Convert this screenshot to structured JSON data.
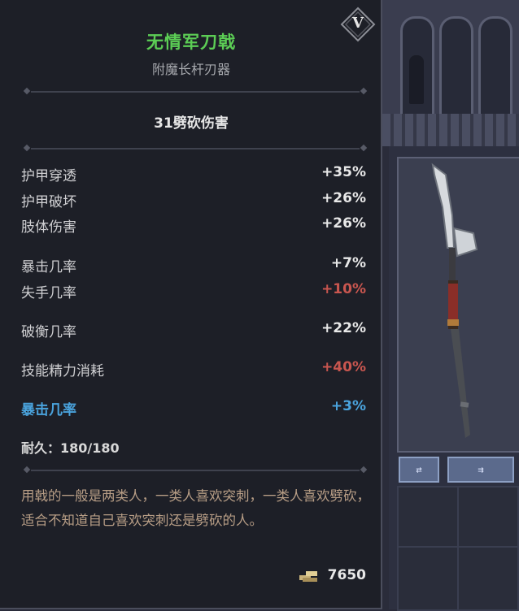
{
  "item": {
    "name": "无情军刀戟",
    "type": "附魔长杆刃器",
    "damage": "31劈砍伤害",
    "rarity_badge": "Ⅴ",
    "stats": [
      {
        "label": "护甲穿透",
        "value": "+35%",
        "tone": "normal"
      },
      {
        "label": "护甲破坏",
        "value": "+26%",
        "tone": "normal"
      },
      {
        "label": "肢体伤害",
        "value": "+26%",
        "tone": "normal"
      },
      {
        "label": "暴击几率",
        "value": "+7%",
        "tone": "normal"
      },
      {
        "label": "失手几率",
        "value": "+10%",
        "tone": "negative"
      },
      {
        "label": "破衡几率",
        "value": "+22%",
        "tone": "normal"
      },
      {
        "label": "技能精力消耗",
        "value": "+40%",
        "tone": "negative"
      },
      {
        "label": "暴击几率",
        "value": "+3%",
        "tone": "enchant"
      }
    ],
    "durability": "耐久：180/180",
    "description": "用戟的一般是两类人，一类人喜欢突刺，一类人喜欢劈砍，适合不知道自己喜欢突刺还是劈砍的人。",
    "price": "7650",
    "icons": {
      "price": "gold-coins-icon",
      "weapon": "halberd-icon"
    }
  },
  "inventory": {
    "swap_button": "⇄",
    "arrange_button": "⇉"
  },
  "colors": {
    "name": "#5ccd55",
    "negative": "#c9564f",
    "enchant": "#4aa3dd",
    "description": "#b89e86",
    "panel": "#1d1f27"
  }
}
